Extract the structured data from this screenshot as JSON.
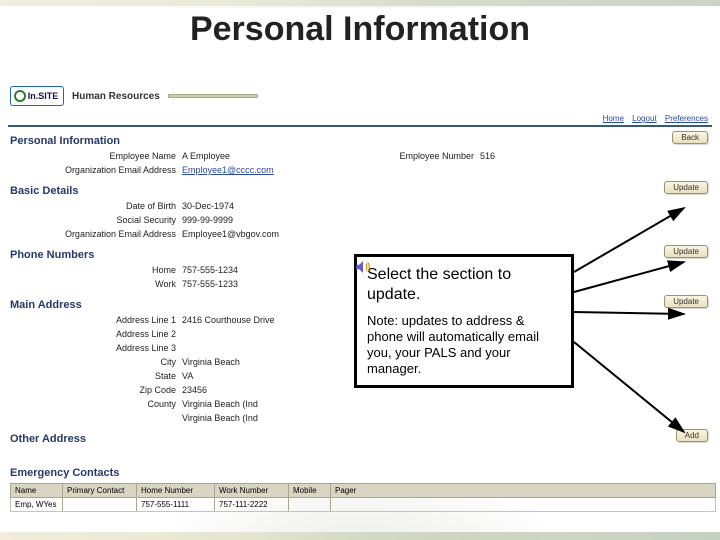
{
  "slide": {
    "title": "Personal Information"
  },
  "app": {
    "logo_text": "In.SITE",
    "module": "Human Resources",
    "links": {
      "home": "Home",
      "logout": "Logout",
      "prefs": "Preferences"
    }
  },
  "sections": {
    "personal": {
      "title": "Personal Information",
      "emp_name_label": "Employee Name",
      "emp_name": "A Employee",
      "emp_num_label": "Employee Number",
      "emp_num": "516",
      "org_email_label": "Organization Email Address",
      "org_email": "Employee1@cccc.com",
      "back_btn": "Back"
    },
    "basic": {
      "title": "Basic Details",
      "dob_label": "Date of Birth",
      "dob": "30-Dec-1974",
      "ssn_label": "Social Security",
      "ssn": "999-99-9999",
      "org_email_label": "Organization Email Address",
      "org_email": "Employee1@vbgov.com",
      "update_btn": "Update"
    },
    "phone": {
      "title": "Phone Numbers",
      "home_label": "Home",
      "home": "757-555-1234",
      "work_label": "Work",
      "work": "757-555-1233",
      "update_btn": "Update"
    },
    "main_addr": {
      "title": "Main Address",
      "l1_label": "Address Line 1",
      "l1": "2416 Courthouse Drive",
      "l2_label": "Address Line 2",
      "l2": "",
      "l3_label": "Address Line 3",
      "l3": "",
      "city_label": "City",
      "city": "Virginia Beach",
      "state_label": "State",
      "state": "VA",
      "zip_label": "Zip Code",
      "zip": "23456",
      "county_label": "County",
      "county": "Virginia Beach (Ind",
      "extra": "Virginia Beach (Ind",
      "update_btn": "Update"
    },
    "other_addr": {
      "title": "Other Address",
      "add_btn": "Add"
    },
    "emergency": {
      "title": "Emergency Contacts",
      "cols": {
        "name": "Name",
        "primary": "Primary Contact",
        "home": "Home Number",
        "work": "Work Number",
        "mobile": "Mobile",
        "pager": "Pager"
      },
      "row": {
        "name": "Emp, WYes",
        "primary": "",
        "home": "757-555-1111",
        "work": "757-111-2222",
        "mobile": "",
        "pager": ""
      }
    }
  },
  "callout": {
    "heading": "Select the section to update.",
    "note": "Note: updates to address & phone will automatically email you, your PALS and your manager."
  }
}
